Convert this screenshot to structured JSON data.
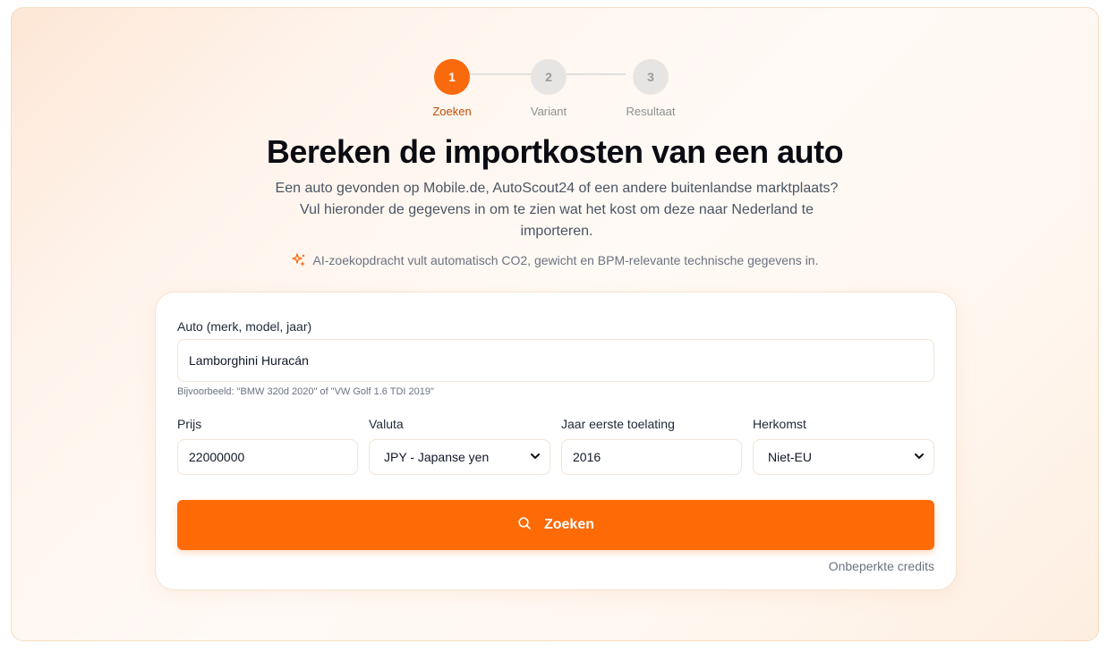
{
  "stepper": {
    "steps": [
      {
        "number": "1",
        "label": "Zoeken"
      },
      {
        "number": "2",
        "label": "Variant"
      },
      {
        "number": "3",
        "label": "Resultaat"
      }
    ]
  },
  "header": {
    "title": "Bereken de importkosten van een auto",
    "intro_line1": "Een auto gevonden op Mobile.de, AutoScout24 of een andere buitenlandse marktplaats?",
    "intro_line2": "Vul hieronder de gegevens in om te zien wat het kost om deze naar Nederland te",
    "intro_line3": "importeren.",
    "ai_note": "AI-zoekopdracht vult automatisch CO2, gewicht en BPM-relevante technische gegevens in."
  },
  "form": {
    "car": {
      "label": "Auto (merk, model, jaar)",
      "value": "Lamborghini Huracán",
      "hint": "Bijvoorbeeld: \"BMW 320d 2020\" of \"VW Golf 1.6 TDI 2019\""
    },
    "price": {
      "label": "Prijs",
      "value": "22000000"
    },
    "currency": {
      "label": "Valuta",
      "value": "JPY - Japanse yen"
    },
    "year": {
      "label": "Jaar eerste toelating",
      "value": "2016"
    },
    "origin": {
      "label": "Herkomst",
      "value": "Niet-EU"
    },
    "submit_label": "Zoeken",
    "credits": "Onbeperkte credits"
  },
  "colors": {
    "accent": "#fe6a06",
    "accent_dark": "#c24d06",
    "inactive_step": "#e7e5e4"
  },
  "icons": {
    "ai": "sparkles-icon",
    "search": "search-icon",
    "select": "chevron-down-icon"
  }
}
